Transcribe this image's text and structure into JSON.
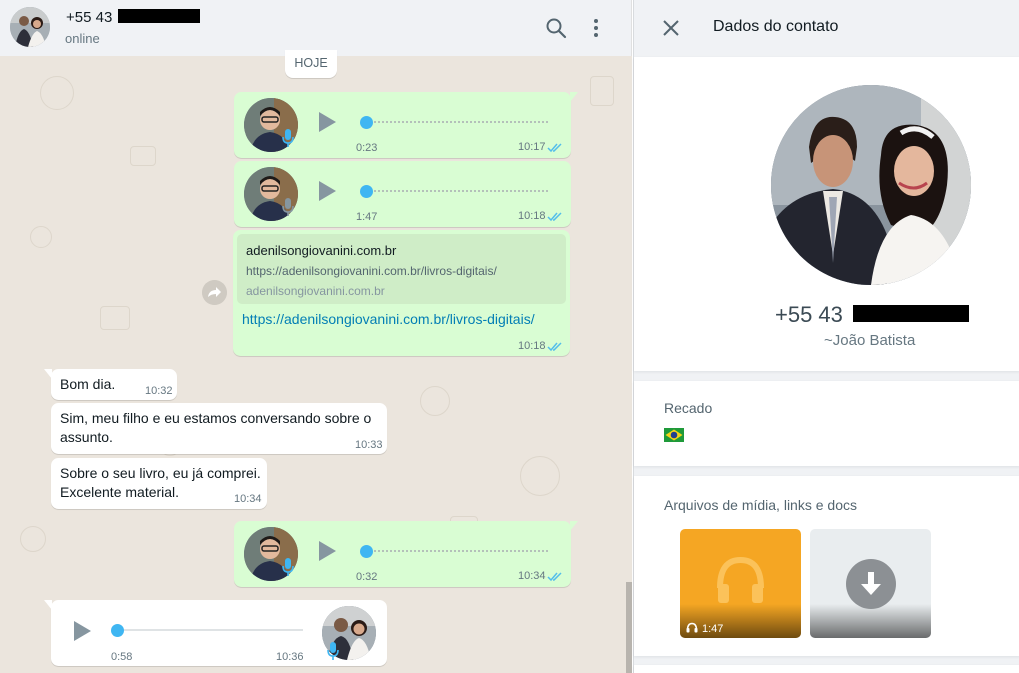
{
  "chat": {
    "title_prefix": "+55 43",
    "status": "online",
    "date_separator": "HOJE",
    "messages": [
      {
        "type": "voice",
        "direction": "out",
        "duration": "0:23",
        "time": "10:17"
      },
      {
        "type": "voice",
        "direction": "out",
        "duration": "1:47",
        "time": "10:18"
      },
      {
        "type": "link",
        "direction": "out",
        "preview_title": "adenilsongiovanini.com.br",
        "preview_description": "https://adenilsongiovanini.com.br/livros-digitais/",
        "preview_host": "adenilsongiovanini.com.br",
        "url_text": "https://adenilsongiovanini.com.br/livros-digitais/",
        "time": "10:18"
      },
      {
        "type": "text",
        "direction": "in",
        "text": "Bom dia.",
        "time": "10:32"
      },
      {
        "type": "text",
        "direction": "in",
        "text_lines": [
          "Sim, meu filho e eu estamos conversando sobre o",
          "assunto."
        ],
        "time": "10:33"
      },
      {
        "type": "text",
        "direction": "in",
        "text_lines": [
          "Sobre o seu livro, eu já comprei.",
          "Excelente material."
        ],
        "time": "10:34"
      },
      {
        "type": "voice",
        "direction": "out",
        "duration": "0:32",
        "time": "10:34"
      },
      {
        "type": "voice",
        "direction": "in",
        "duration": "0:58",
        "time": "10:36"
      }
    ]
  },
  "info": {
    "title": "Dados do contato",
    "phone_prefix": "+55 43",
    "name": "~João Batista",
    "about_label": "Recado",
    "about_emoji": "brazil-flag",
    "media_label": "Arquivos de mídia, links e docs",
    "media_items": [
      {
        "kind": "audio",
        "duration": "1:47",
        "color": "#f5a623"
      },
      {
        "kind": "download",
        "color": "#e9edef"
      }
    ]
  },
  "colors": {
    "outgoing_bubble": "#d9fdd3",
    "incoming_bubble": "#ffffff",
    "read_ticks": "#53bdeb",
    "voice_knob": "#3fb6f2",
    "link": "#027eb5"
  },
  "icons": [
    "search-icon",
    "menu-dots-icon",
    "close-icon",
    "play-icon",
    "mic-icon",
    "double-check-icon",
    "forward-icon",
    "headphones-icon",
    "download-icon"
  ]
}
